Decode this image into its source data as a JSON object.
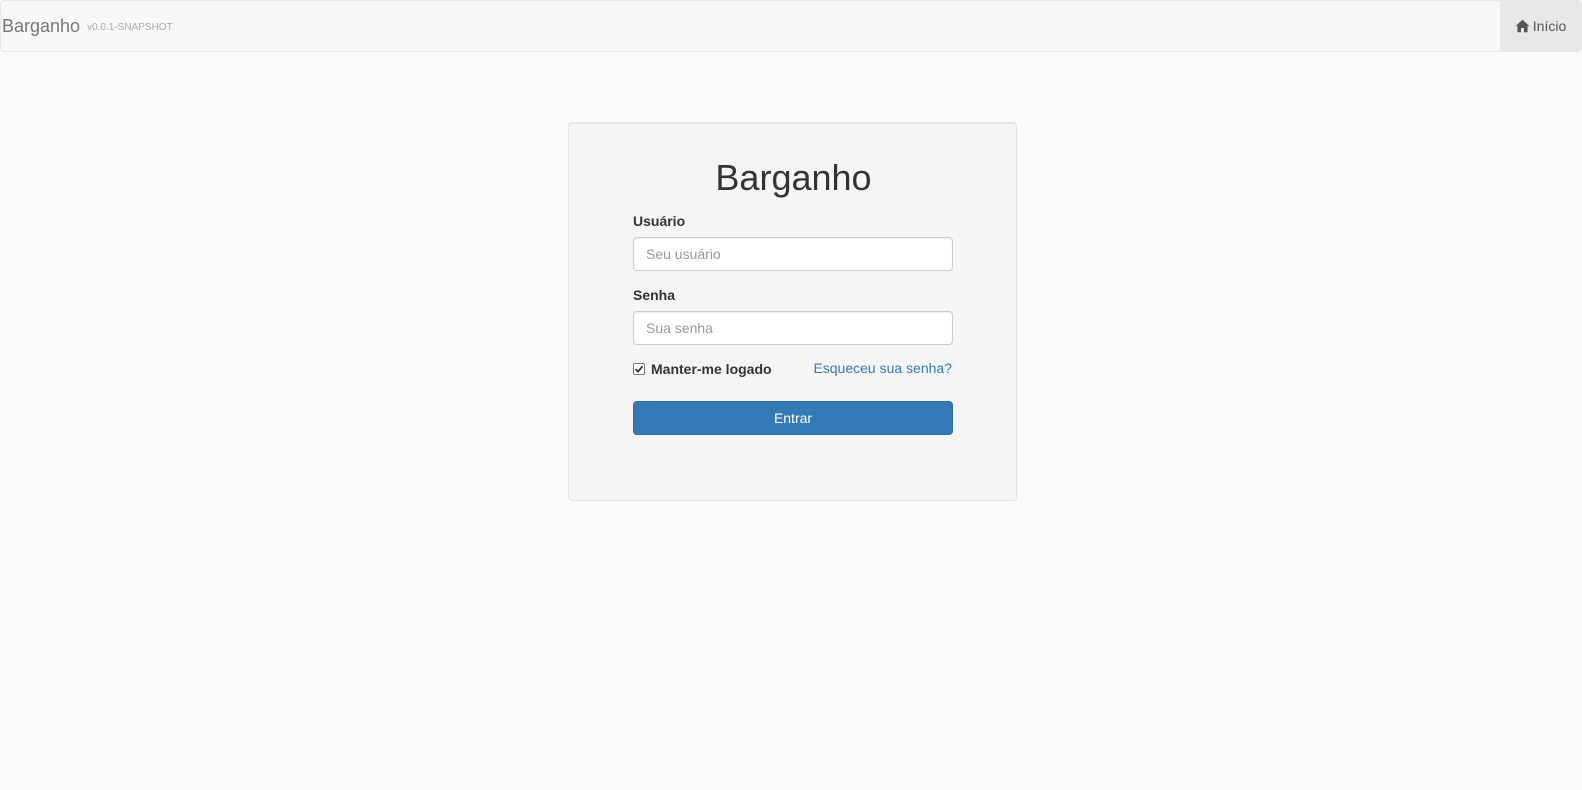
{
  "navbar": {
    "brand": "Barganho",
    "version": "v0.0.1-SNAPSHOT",
    "home_label": "Início",
    "home_icon": "home-icon"
  },
  "login": {
    "title": "Barganho",
    "username_label": "Usuário",
    "username_placeholder": "Seu usuário",
    "username_value": "",
    "password_label": "Senha",
    "password_placeholder": "Sua senha",
    "password_value": "",
    "remember_label": "Manter-me logado",
    "remember_checked": true,
    "forgot_label": "Esqueceu sua senha?",
    "submit_label": "Entrar"
  },
  "colors": {
    "primary": "#337ab7",
    "link": "#337ab7",
    "navbar_bg": "#f8f8f8",
    "card_bg": "#f5f5f5"
  }
}
